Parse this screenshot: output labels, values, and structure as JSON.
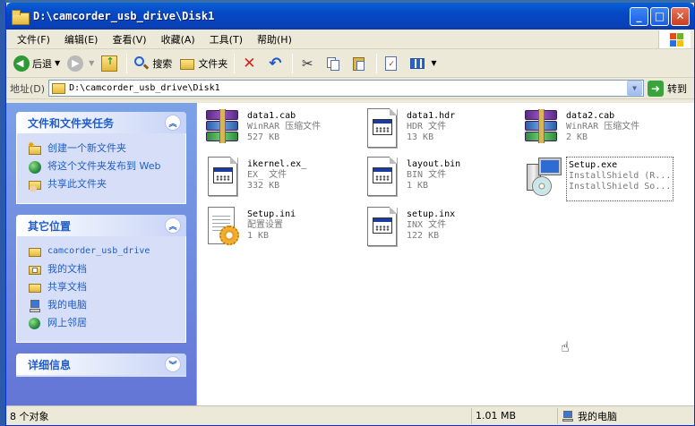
{
  "window": {
    "title": "D:\\camcorder_usb_drive\\Disk1"
  },
  "menubar": {
    "items": [
      "文件(F)",
      "编辑(E)",
      "查看(V)",
      "收藏(A)",
      "工具(T)",
      "帮助(H)"
    ]
  },
  "toolbar": {
    "back_label": "后退",
    "search_label": "搜索",
    "folders_label": "文件夹"
  },
  "address": {
    "label": "地址(D)",
    "value": "D:\\camcorder_usb_drive\\Disk1",
    "go_label": "转到"
  },
  "taskpane": {
    "file_tasks": {
      "title": "文件和文件夹任务",
      "items": [
        "创建一个新文件夹",
        "将这个文件夹发布到 Web",
        "共享此文件夹"
      ]
    },
    "other_places": {
      "title": "其它位置",
      "items": [
        "camcorder_usb_drive",
        "我的文档",
        "共享文档",
        "我的电脑",
        "网上邻居"
      ]
    },
    "details": {
      "title": "详细信息"
    }
  },
  "files": [
    {
      "name": "data1.cab",
      "type": "WinRAR 压缩文件",
      "size": "527 KB",
      "icon": "winrar-archive-icon"
    },
    {
      "name": "data1.hdr",
      "type": "HDR 文件",
      "size": "13 KB",
      "icon": "generic-file-icon"
    },
    {
      "name": "data2.cab",
      "type": "WinRAR 压缩文件",
      "size": "2 KB",
      "icon": "winrar-archive-icon"
    },
    {
      "name": "ikernel.ex_",
      "type": "EX_ 文件",
      "size": "332 KB",
      "icon": "generic-file-icon"
    },
    {
      "name": "layout.bin",
      "type": "BIN 文件",
      "size": "1 KB",
      "icon": "generic-file-icon"
    },
    {
      "name": "Setup.exe",
      "type": "InstallShield (R...",
      "size": "InstallShield So...",
      "icon": "installer-icon"
    },
    {
      "name": "Setup.ini",
      "type": "配置设置",
      "size": "1 KB",
      "icon": "config-settings-icon"
    },
    {
      "name": "setup.inx",
      "type": "INX 文件",
      "size": "122 KB",
      "icon": "generic-file-icon"
    }
  ],
  "statusbar": {
    "objects": "8 个对象",
    "size": "1.01 MB",
    "location": "我的电脑"
  },
  "colors": {
    "titlebar": "#0548c4",
    "taskpane": "#6f8fe0",
    "link": "#215dc6"
  }
}
